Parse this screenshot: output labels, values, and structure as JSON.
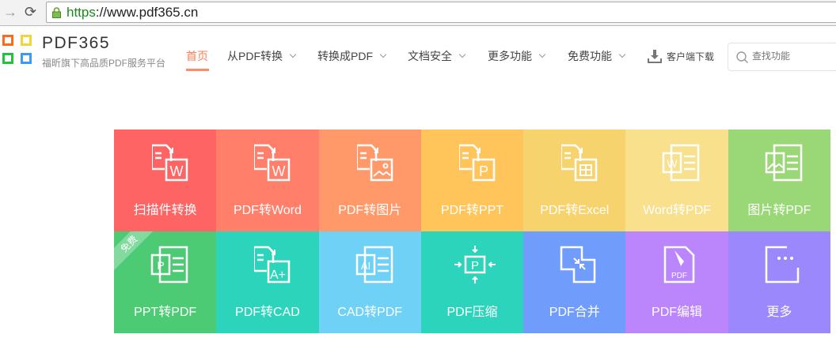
{
  "browser": {
    "url_scheme": "https",
    "url_rest": "://www.pdf365.cn"
  },
  "header": {
    "brand": "PDF365",
    "tagline": "福昕旗下高品质PDF服务平台",
    "logo_colors": [
      "#ff6a1a",
      "#f5d33a",
      "#1ec43c",
      "#3a9af5"
    ],
    "menu": [
      {
        "label": "首页",
        "active": true
      },
      {
        "label": "从PDF转换"
      },
      {
        "label": "转换成PDF"
      },
      {
        "label": "文档安全"
      },
      {
        "label": "更多功能"
      },
      {
        "label": "免费功能"
      }
    ],
    "download_label": "客户端下载",
    "search_placeholder": "查找功能"
  },
  "tiles": [
    {
      "label": "扫描件转换",
      "color": "#ff6464",
      "icon": "scan-to-word-icon"
    },
    {
      "label": "PDF转Word",
      "color": "#ff7f6a",
      "icon": "pdf-to-word-icon"
    },
    {
      "label": "PDF转图片",
      "color": "#ff996a",
      "icon": "pdf-to-image-icon"
    },
    {
      "label": "PDF转PPT",
      "color": "#ffc45a",
      "icon": "pdf-to-ppt-icon"
    },
    {
      "label": "PDF转Excel",
      "color": "#f7d36d",
      "icon": "pdf-to-excel-icon"
    },
    {
      "label": "Word转PDF",
      "color": "#f8e08c",
      "icon": "word-to-pdf-icon"
    },
    {
      "label": "图片转PDF",
      "color": "#9ad877",
      "icon": "image-to-pdf-icon"
    },
    {
      "label": "PPT转PDF",
      "color": "#4ccb74",
      "icon": "ppt-to-pdf-icon",
      "badge": "免费"
    },
    {
      "label": "PDF转CAD",
      "color": "#2dd4bc",
      "icon": "pdf-to-cad-icon"
    },
    {
      "label": "CAD转PDF",
      "color": "#6fd1f5",
      "icon": "cad-to-pdf-icon"
    },
    {
      "label": "PDF压缩",
      "color": "#2dd4bc",
      "icon": "compress-icon"
    },
    {
      "label": "PDF合并",
      "color": "#709cfc",
      "icon": "merge-icon"
    },
    {
      "label": "PDF编辑",
      "color": "#bb85fc",
      "icon": "edit-pdf-icon",
      "icon_text": "PDF"
    },
    {
      "label": "更多",
      "color": "#9b88fc",
      "icon": "more-icon"
    }
  ]
}
